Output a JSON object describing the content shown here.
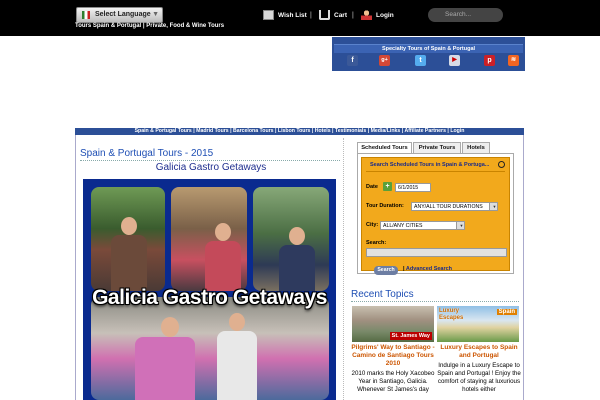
{
  "header": {
    "language_button": "Select Language",
    "tagline": "Tours Spain & Portugal | Private, Food & Wine Tours",
    "nav": [
      "Wish List",
      "Cart",
      "Login"
    ],
    "separator": "|",
    "search_placeholder": "Search..."
  },
  "specialty": {
    "title": "Specialty Tours of Spain & Portugal",
    "social": [
      "facebook",
      "google-plus",
      "twitter",
      "youtube",
      "pinterest",
      "rss"
    ]
  },
  "main_nav": [
    "Spain & Portugal Tours",
    "Madrid Tours",
    "Barcelona Tours",
    "Lisbon Tours",
    "Hotels",
    "Testimonials",
    "Media/Links",
    "Affiliate Partners",
    "Login"
  ],
  "article": {
    "title": "Spain & Portugal Tours - 2015",
    "subtitle": "Galicia Gastro Getaways",
    "image_overlay": "Galicia Gastro Getaways"
  },
  "tours_widget": {
    "tabs": [
      "Scheduled Tours",
      "Private Tours",
      "Hotels"
    ],
    "panel_title": "Search Scheduled Tours in Spain & Portuga...",
    "date_label": "Date",
    "date_value": "6/1/2015",
    "duration_label": "Tour Duration:",
    "duration_value": "ANY/ALL TOUR DURATIONS",
    "city_label": "City:",
    "city_value": "ALL/ANY CITIES",
    "search_label": "Search:",
    "search_button": "Search",
    "separator": "|",
    "advanced_link": "Advanced Search"
  },
  "recent": {
    "title": "Recent Topics",
    "posts": [
      {
        "image_caption": "St. James Way",
        "title": "Pilgrims' Way to Santiago - Camino de Santiago Tours 2010",
        "excerpt": "2010 marks the Holy Xacobeo Year in Santiago, Galicia. Whenever St James's day"
      },
      {
        "image_caption_left": "Luxury Escapes",
        "image_caption_right": "Spain",
        "title": "Luxury Escapes to Spain and Portugal",
        "excerpt": "Indulge in a Luxury Escape to Spain and Portugal ! Enjoy the comfort of staying at luxurious hotels either"
      }
    ]
  }
}
